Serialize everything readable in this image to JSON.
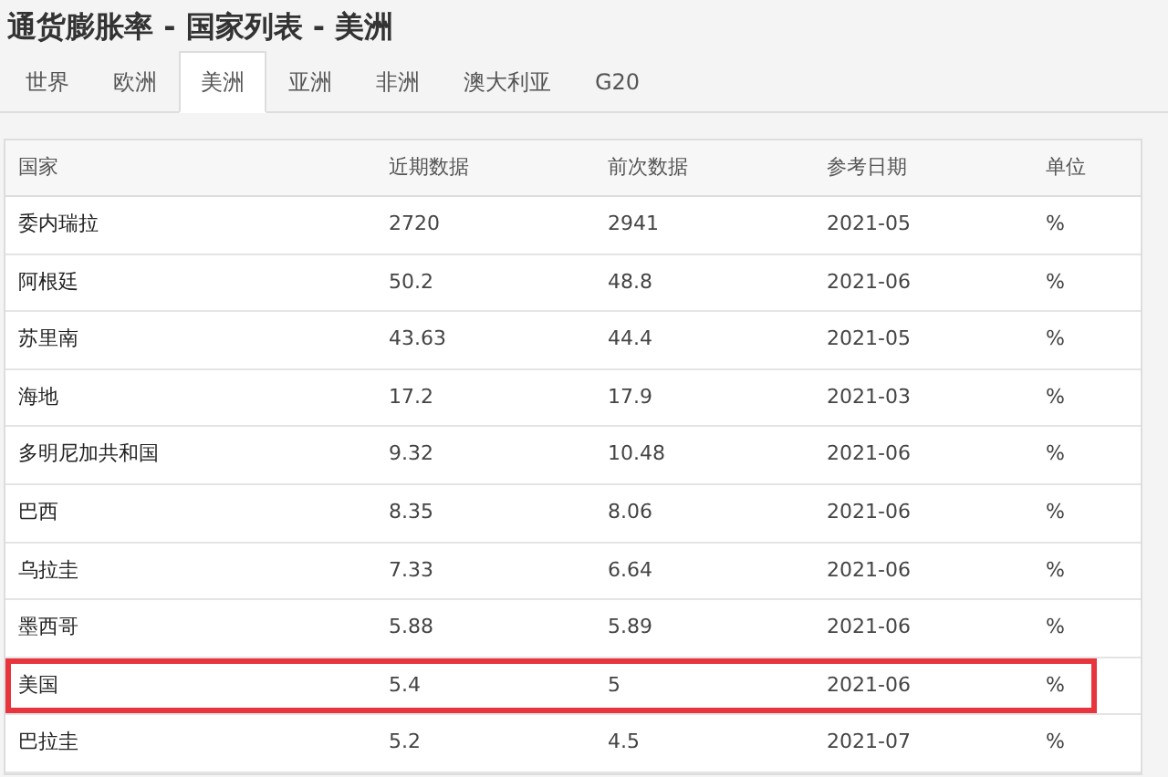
{
  "title": "通货膨胀率 - 国家列表 - 美洲",
  "tabs": [
    {
      "label": "世界",
      "selected": false
    },
    {
      "label": "欧洲",
      "selected": false
    },
    {
      "label": "美洲",
      "selected": true
    },
    {
      "label": "亚洲",
      "selected": false
    },
    {
      "label": "非洲",
      "selected": false
    },
    {
      "label": "澳大利亚",
      "selected": false
    },
    {
      "label": "G20",
      "selected": false
    }
  ],
  "table": {
    "columns": [
      "国家",
      "近期数据",
      "前次数据",
      "参考日期",
      "单位"
    ],
    "rows": [
      {
        "cells": [
          "委内瑞拉",
          "2720",
          "2941",
          "2021-05",
          "%"
        ],
        "highlighted": false
      },
      {
        "cells": [
          "阿根廷",
          "50.2",
          "48.8",
          "2021-06",
          "%"
        ],
        "highlighted": false
      },
      {
        "cells": [
          "苏里南",
          "43.63",
          "44.4",
          "2021-05",
          "%"
        ],
        "highlighted": false
      },
      {
        "cells": [
          "海地",
          "17.2",
          "17.9",
          "2021-03",
          "%"
        ],
        "highlighted": false
      },
      {
        "cells": [
          "多明尼加共和国",
          "9.32",
          "10.48",
          "2021-06",
          "%"
        ],
        "highlighted": false
      },
      {
        "cells": [
          "巴西",
          "8.35",
          "8.06",
          "2021-06",
          "%"
        ],
        "highlighted": false
      },
      {
        "cells": [
          "乌拉圭",
          "7.33",
          "6.64",
          "2021-06",
          "%"
        ],
        "highlighted": false
      },
      {
        "cells": [
          "墨西哥",
          "5.88",
          "5.89",
          "2021-06",
          "%"
        ],
        "highlighted": false
      },
      {
        "cells": [
          "美国",
          "5.4",
          "5",
          "2021-06",
          "%"
        ],
        "highlighted": true
      },
      {
        "cells": [
          "巴拉圭",
          "5.2",
          "4.5",
          "2021-07",
          "%"
        ],
        "highlighted": false
      }
    ]
  }
}
